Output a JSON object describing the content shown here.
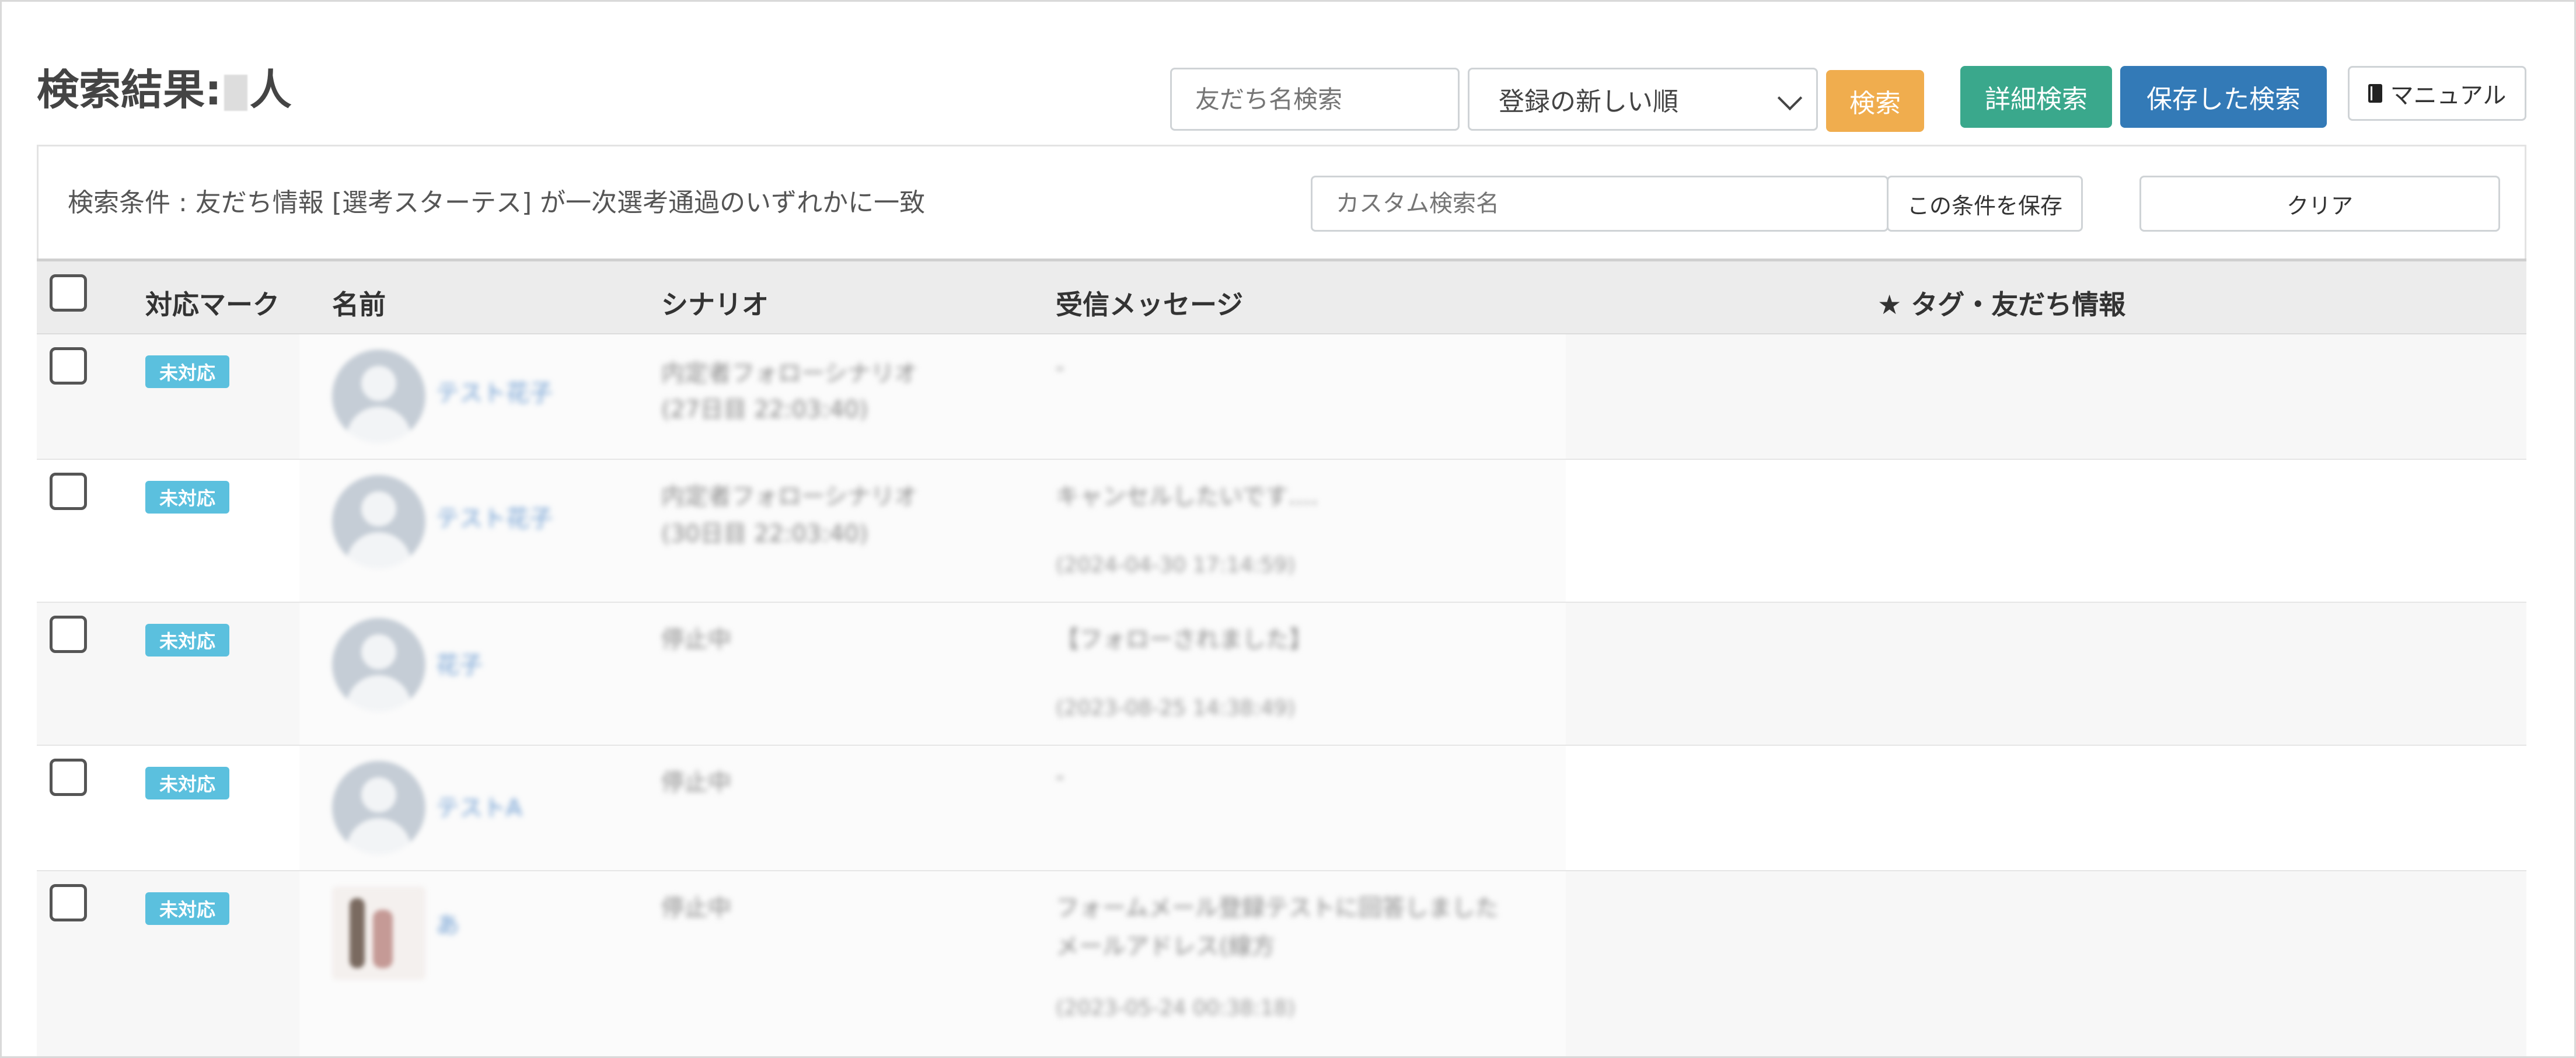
{
  "header": {
    "title_prefix": "検索結果:",
    "title_suffix": "人"
  },
  "toolbar": {
    "name_search_placeholder": "友だち名検索",
    "sort_selected": "登録の新しい順",
    "search_label": "検索",
    "advanced_search_label": "詳細検索",
    "saved_search_label": "保存した検索",
    "manual_label": "マニュアル"
  },
  "conditions": {
    "text": "検索条件 : 友だち情報 [選考スターテス] が一次選考通過のいずれかに一致",
    "custom_name_placeholder": "カスタム検索名",
    "save_label": "この条件を保存",
    "clear_label": "クリア"
  },
  "table": {
    "columns": [
      "対応マーク",
      "名前",
      "シナリオ",
      "受信メッセージ",
      "★ タグ・友だち情報"
    ],
    "rows": [
      {
        "status": "未対応",
        "name": "テスト花子",
        "scenario_line1": "内定者フォローシナリオ",
        "scenario_line2": "(27日目 22:03:40)",
        "message_line1": "-",
        "message_line2": "",
        "message_time": "",
        "avatar": "placeholder"
      },
      {
        "status": "未対応",
        "name": "テスト花子",
        "scenario_line1": "内定者フォローシナリオ",
        "scenario_line2": "(30日目 22:03:40)",
        "message_line1": "キャンセルしたいです....",
        "message_line2": "",
        "message_time": "(2024-04-30 17:14:59)",
        "avatar": "placeholder"
      },
      {
        "status": "未対応",
        "name": "花子",
        "scenario_line1": "停止中",
        "scenario_line2": "",
        "message_line1": "【フォローされました】",
        "message_line2": "",
        "message_time": "(2023-08-25 14:38:49)",
        "avatar": "placeholder"
      },
      {
        "status": "未対応",
        "name": "テストA",
        "scenario_line1": "停止中",
        "scenario_line2": "",
        "message_line1": "-",
        "message_line2": "",
        "message_time": "",
        "avatar": "placeholder"
      },
      {
        "status": "未対応",
        "name": "あ",
        "scenario_line1": "停止中",
        "scenario_line2": "",
        "message_line1": "フォームメール登録テストに回答しました",
        "message_line2": "メールアドレス(線方",
        "message_time": "(2023-05-24 00:38:18)",
        "avatar": "photo"
      }
    ]
  },
  "colors": {
    "badge": "#5bc0de",
    "search_button": "#f0ad4e",
    "advanced_button": "#3aa88c",
    "saved_button": "#337ab7"
  }
}
